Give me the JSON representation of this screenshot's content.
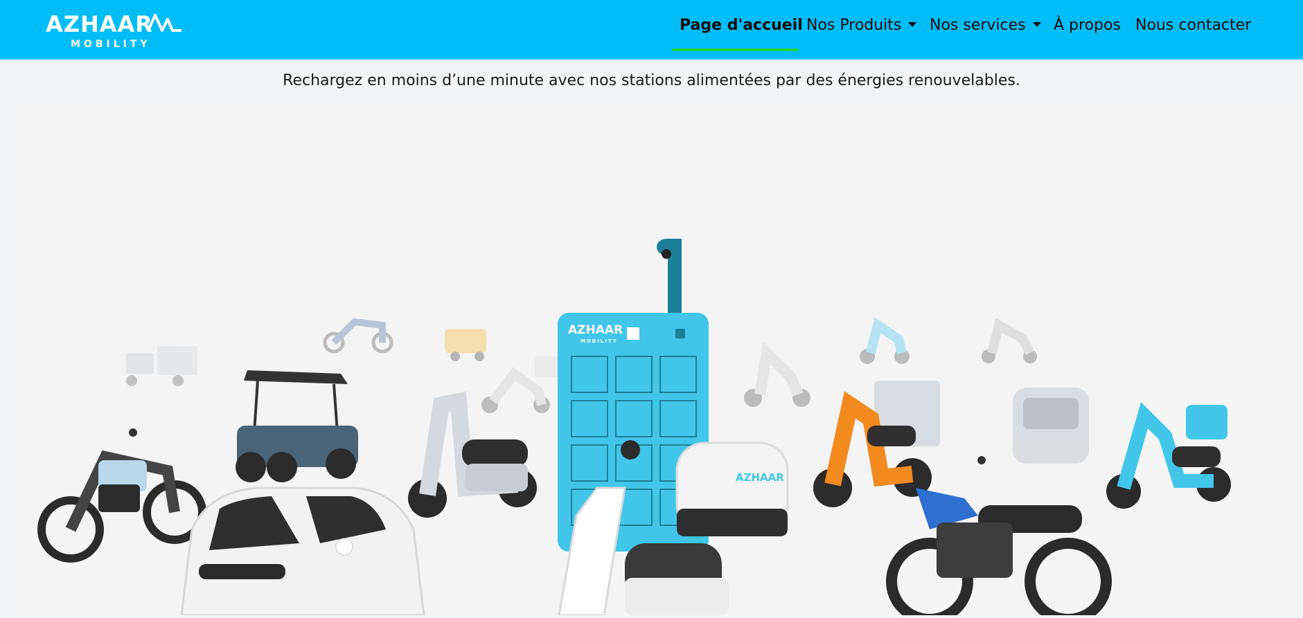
{
  "brand": {
    "name": "AZHAAR",
    "sub": "MOBILITY",
    "colors": {
      "nav_bg": "#00bdf7",
      "active_underline": "#22d33a",
      "station_blue": "#41c6ea",
      "teal": "#1b7f99"
    }
  },
  "nav": {
    "items": [
      {
        "label": "Page d'accueil",
        "active": true
      },
      {
        "label": "Nos Produits",
        "dropdown": true
      },
      {
        "label": "Nos services",
        "dropdown": true
      },
      {
        "label": "À propos"
      },
      {
        "label": "Nous contacter"
      }
    ]
  },
  "hero": {
    "subtitle": "Rechargez en moins d’une minute avec nos stations alimentées par des énergies renouvelables."
  },
  "icons": {
    "logo": "azhaar-mobility-logo",
    "caret": "chevron-down-icon",
    "camera": "camera-icon",
    "qr": "qr-code-icon"
  }
}
